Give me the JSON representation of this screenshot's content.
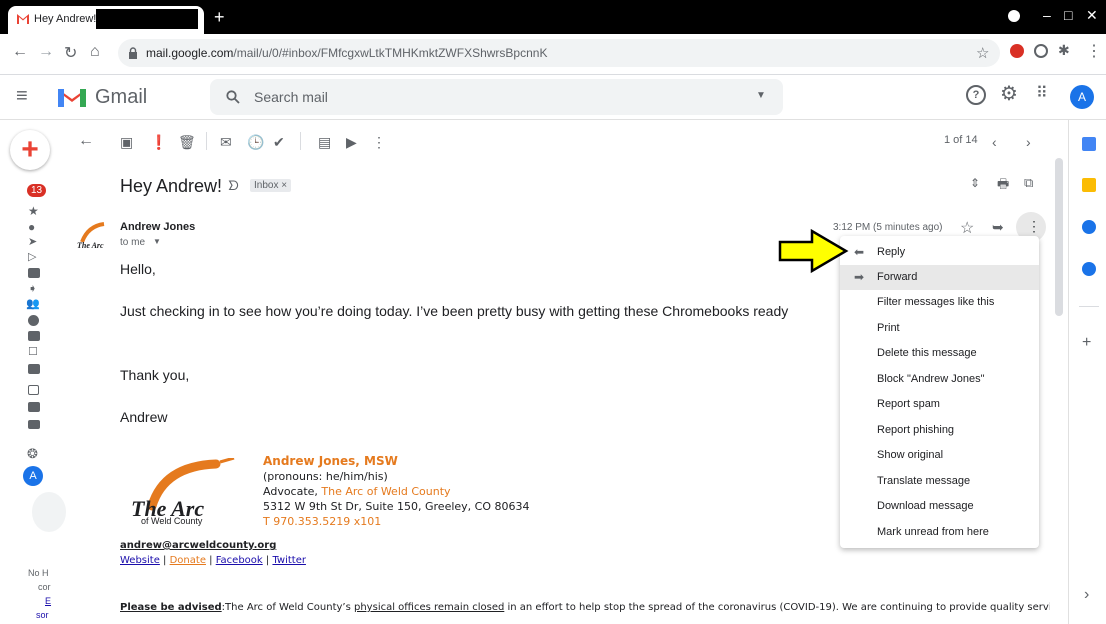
{
  "browser": {
    "tab_title": "Hey Andrew! -",
    "new_tab_symbol": "+",
    "url_host": "mail.google.com",
    "url_path": "/mail/u/0/#inbox/FMfcgxwLtkTMHKmktZWFXShwrsBpcnnK"
  },
  "gmail": {
    "logo_text": "Gmail",
    "search_placeholder": "Search mail",
    "avatar_letter": "A",
    "unread_badge": "13",
    "pagination": "1 of 14"
  },
  "message": {
    "subject": "Hey Andrew!",
    "label_chip": "Inbox ×",
    "sender": "Andrew Jones",
    "recipient": "to me",
    "timestamp": "3:12 PM (5 minutes ago)",
    "body": {
      "greeting": "Hello,",
      "paragraph": "Just checking in to see how you’re doing today. I’ve been pretty busy with getting these Chromebooks ready",
      "closing": "Thank you,",
      "signoff": "Andrew"
    },
    "signature": {
      "name": "Andrew Jones, MSW",
      "pronouns": "(pronouns: he/him/his)",
      "title_prefix": "Advocate, ",
      "organization": "The Arc of Weld County",
      "address": "5312 W 9th St Dr, Suite 150, Greeley, CO 80634",
      "phone": "T 970.353.5219 x101",
      "logo_text": "The Arc",
      "logo_sub": "of Weld County",
      "email": "andrew@arcweldcounty.org",
      "links": [
        "Website",
        "Donate",
        "Facebook",
        "Twitter"
      ]
    },
    "advisory_label": "Please be advised",
    "advisory_text": ":The Arc of Weld County’s ",
    "advisory_link": "physical offices remain closed",
    "advisory_rest": " in an effort to help stop the spread of the coronavirus (COVID-19). We are continuing to provide quality services"
  },
  "left_rail_footer": [
    "No H",
    "cor",
    "E",
    "sor"
  ],
  "context_menu": {
    "items": [
      "Reply",
      "Forward",
      "Filter messages like this",
      "Print",
      "Delete this message",
      "Block \"Andrew Jones\"",
      "Report spam",
      "Report phishing",
      "Show original",
      "Translate message",
      "Download message",
      "Mark unread from here"
    ],
    "highlighted_index": 1
  },
  "colors": {
    "arrow_fill": "#ffff00",
    "gmail_red": "#ea4335",
    "accent_blue": "#1a73e8",
    "arc_orange": "#e57a1e"
  }
}
